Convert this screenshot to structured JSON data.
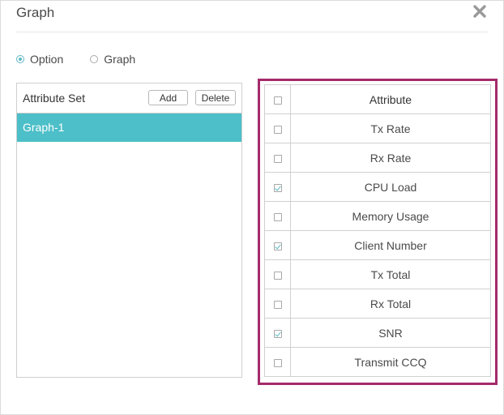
{
  "dialog": {
    "title": "Graph",
    "close_icon": "close-icon"
  },
  "mode": {
    "options": [
      {
        "label": "Option",
        "selected": true
      },
      {
        "label": "Graph",
        "selected": false
      }
    ]
  },
  "attribute_set": {
    "title": "Attribute Set",
    "add_label": "Add",
    "delete_label": "Delete",
    "items": [
      {
        "label": "Graph-1",
        "selected": true
      }
    ],
    "selected_color": "#4dbfc8"
  },
  "attributes": {
    "header": "Attribute",
    "rows": [
      {
        "label": "Tx Rate",
        "checked": false
      },
      {
        "label": "Rx Rate",
        "checked": false
      },
      {
        "label": "CPU Load",
        "checked": true
      },
      {
        "label": "Memory Usage",
        "checked": false
      },
      {
        "label": "Client Number",
        "checked": true
      },
      {
        "label": "Tx Total",
        "checked": false
      },
      {
        "label": "Rx Total",
        "checked": false
      },
      {
        "label": "SNR",
        "checked": true
      },
      {
        "label": "Transmit CCQ",
        "checked": false
      }
    ],
    "highlight_color": "#a52a6a"
  }
}
